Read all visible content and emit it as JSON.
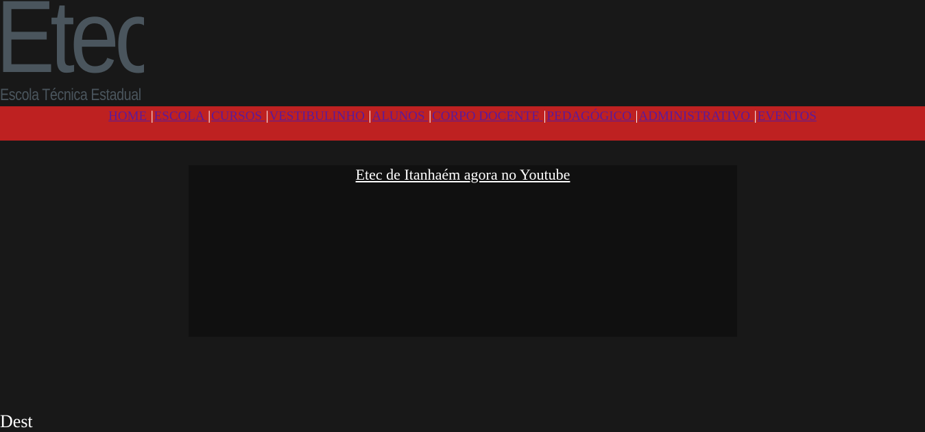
{
  "logo": {
    "main": "Etec",
    "subtitle": "Escola Técnica Estadual"
  },
  "nav": {
    "separator": "|",
    "items": [
      {
        "label": "HOME "
      },
      {
        "label": "ESCOLA "
      },
      {
        "label": "CURSOS "
      },
      {
        "label": "VESTIBULINHO "
      },
      {
        "label": "ALUNOS "
      },
      {
        "label": "CORPO DOCENTE "
      },
      {
        "label": "PEDAGÓGICO "
      },
      {
        "label": "ADMINISTRATIVO "
      },
      {
        "label": "EVENTOS"
      }
    ]
  },
  "video": {
    "title": "Etec de Itanhaém agora no Youtube"
  },
  "footer": {
    "partial_text": "Dest"
  },
  "colors": {
    "background": "#181818",
    "navbar": "#be2121",
    "nav_link": "#5a1a9c",
    "logo": "#4a555d",
    "video_bg": "#101010"
  }
}
